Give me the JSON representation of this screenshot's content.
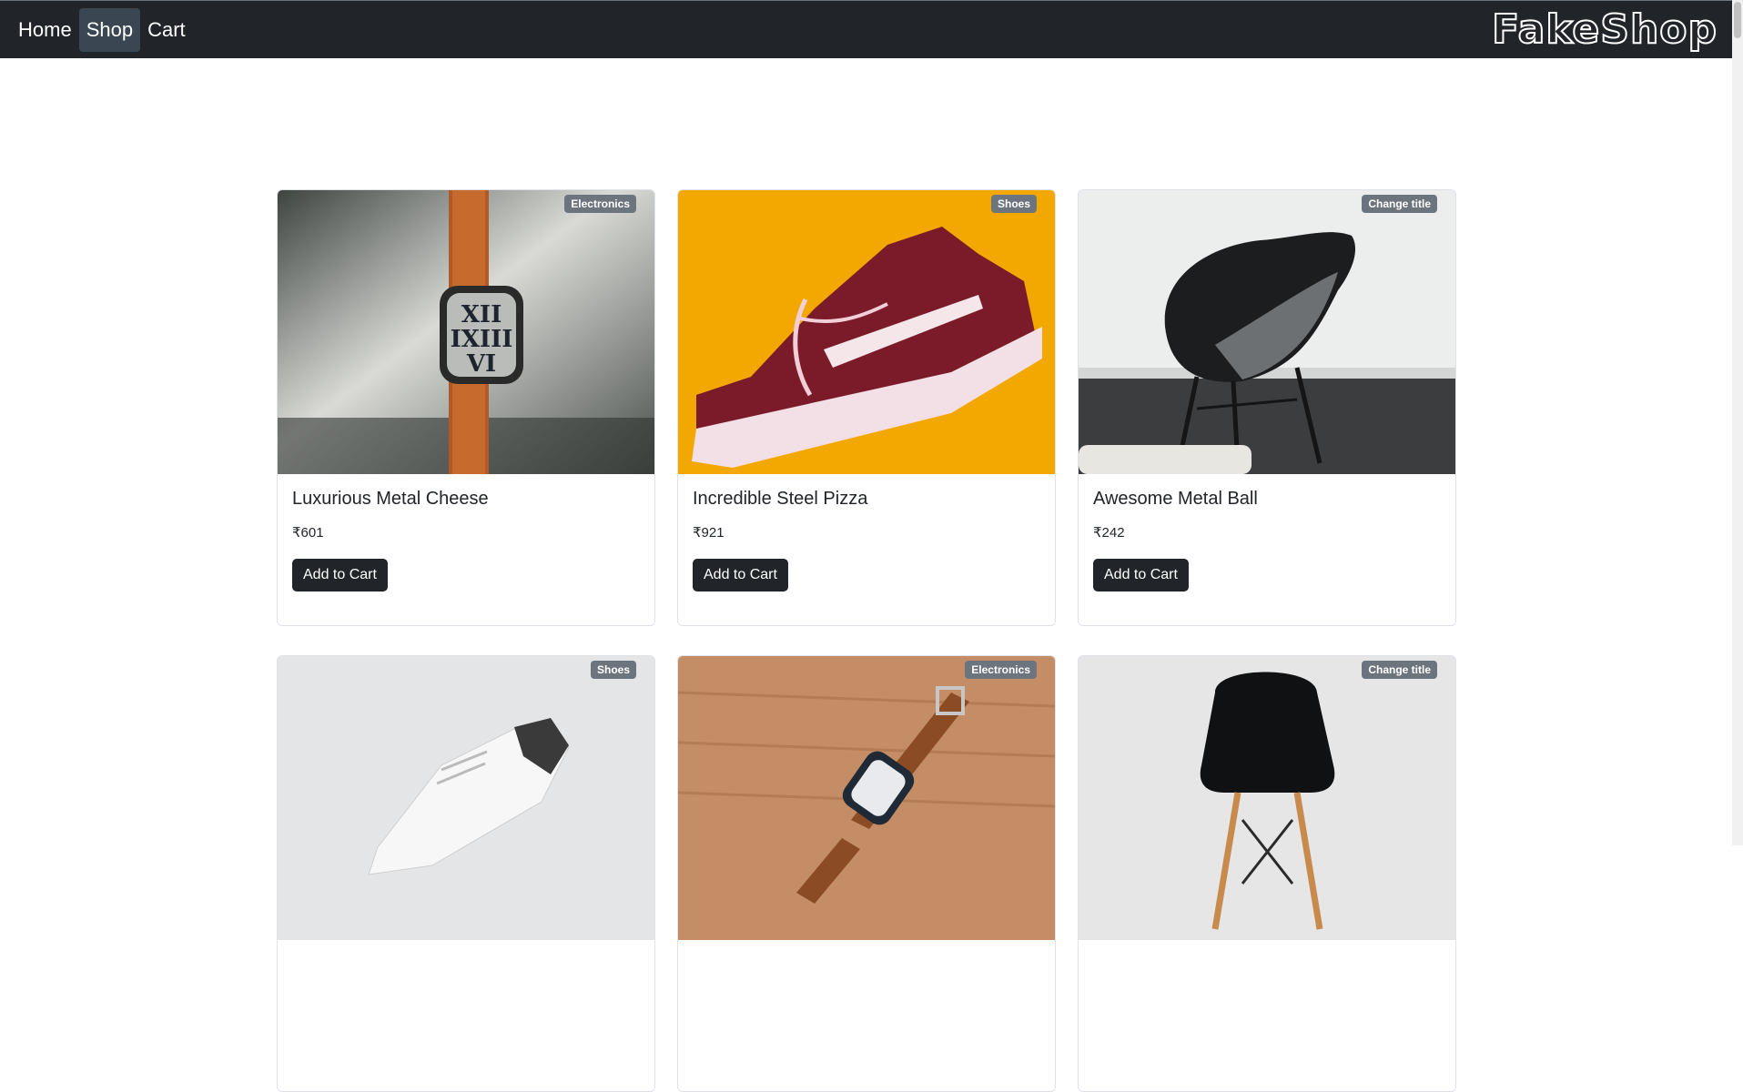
{
  "nav": {
    "links": [
      "Home",
      "Shop",
      "Cart"
    ],
    "active": "Shop",
    "brand": "FakeShop"
  },
  "products": [
    {
      "title": "Luxurious Metal Cheese",
      "price": "₹601",
      "category": "Electronics",
      "button": "Add to Cart",
      "image": "smartwatch-orange-band-photo"
    },
    {
      "title": "Incredible Steel Pizza",
      "price": "₹921",
      "category": "Shoes",
      "button": "Add to Cart",
      "image": "maroon-sneaker-on-yellow-photo"
    },
    {
      "title": "Awesome Metal Ball",
      "price": "₹242",
      "category": "Change title",
      "button": "Add to Cart",
      "image": "black-armchair-photo"
    },
    {
      "title": "",
      "price": "",
      "category": "Shoes",
      "button": "",
      "image": "white-sneaker-photo"
    },
    {
      "title": "",
      "price": "",
      "category": "Electronics",
      "button": "",
      "image": "brown-leather-watch-photo"
    },
    {
      "title": "",
      "price": "",
      "category": "Change title",
      "button": "",
      "image": "black-chair-photo"
    }
  ],
  "colors": {
    "navbar": "#212529",
    "badge": "#6c757d",
    "button": "#212529"
  }
}
